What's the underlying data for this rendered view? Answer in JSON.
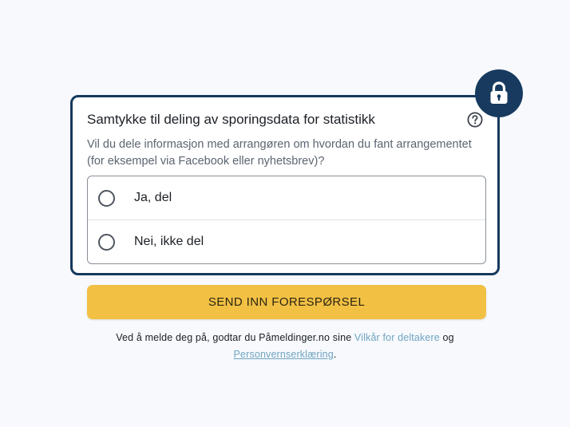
{
  "consent": {
    "title": "Samtykke til deling av sporingsdata for statistikk",
    "description": "Vil du dele informasjon med arrangøren om hvordan du fant arrangementet (for eksempel via Facebook eller nyhetsbrev)?",
    "options": [
      {
        "label": "Ja, del",
        "selected": false
      },
      {
        "label": "Nei, ikke del",
        "selected": false
      }
    ],
    "icons": {
      "badge": "lock-icon",
      "help": "help-icon"
    }
  },
  "submit": {
    "label": "SEND INN FORESPØRSEL"
  },
  "terms": {
    "prefix": "Ved å melde deg på, godtar du Påmeldinger.no sine ",
    "terms_link": "Vilkår for deltakere",
    "middle": " og",
    "privacy_link": "Personvernserklæring",
    "suffix": "."
  },
  "colors": {
    "navy": "#173a5e",
    "button": "#f2c144",
    "link": "#6fa4c2",
    "background": "#f7f9fc"
  }
}
